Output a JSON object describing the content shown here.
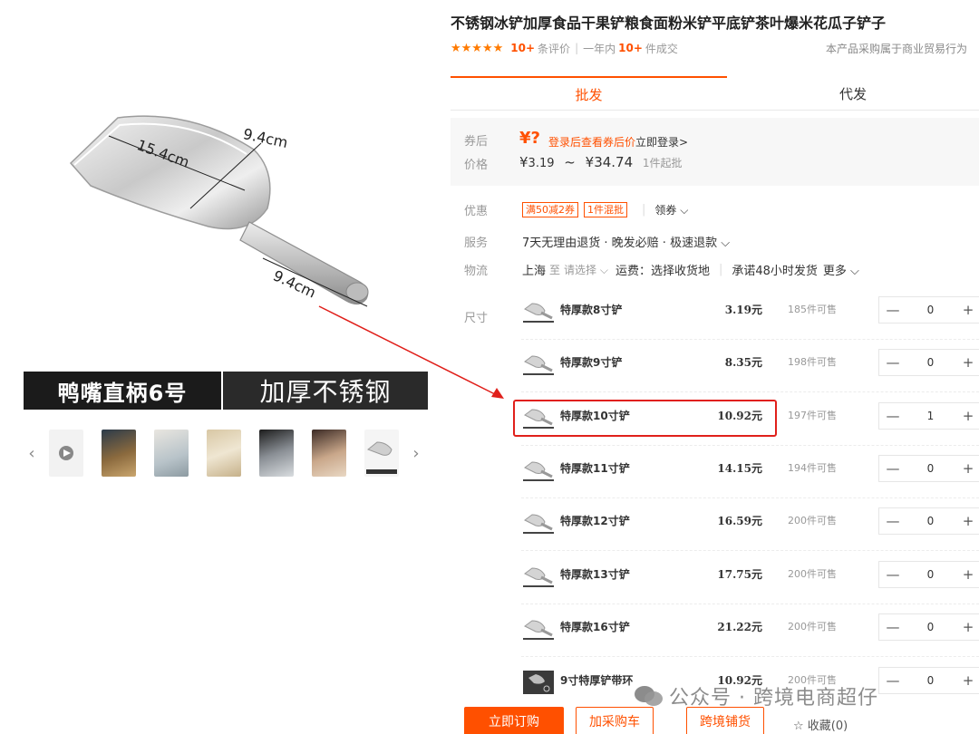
{
  "product": {
    "title": "不锈钢冰铲加厚食品干果铲粮食面粉米铲平底铲茶叶爆米花瓜子铲子",
    "rating_stars": "★★★★★",
    "reviews_count": "10+",
    "reviews_suffix": "条评价",
    "year_sales_prefix": "一年内",
    "year_sales_count": "10+",
    "year_sales_suffix": "件成交",
    "trade_note": "本产品采购属于商业贸易行为"
  },
  "image": {
    "dim_top": "9.4cm",
    "dim_diag": "15.4cm",
    "dim_handle": "9.4cm",
    "banner_left": "鸭嘴直柄6号",
    "banner_right": "加厚不锈钢",
    "prev_arrow": "‹",
    "next_arrow": "›"
  },
  "tabs": [
    {
      "label": "批发"
    },
    {
      "label": "代发"
    }
  ],
  "price": {
    "coupon_label": "券后",
    "price_label": "价格",
    "coupon_value": "¥?",
    "login_orange": "登录后查看券后价",
    "login_dark": "立即登录>",
    "range_low_symbol": "¥",
    "range_low": "3.19",
    "range_sep": "~",
    "range_high_symbol": "¥",
    "range_high": "34.74",
    "min_order": "1件起批"
  },
  "offers": {
    "label": "优惠",
    "tag1": "满50减2券",
    "tag2": "1件混批",
    "coupon_link": "领券 ⌵"
  },
  "service": {
    "label": "服务",
    "text": "7天无理由退货 · 晚发必赔 · 极速退款 ⌵"
  },
  "logistics": {
    "label": "物流",
    "from": "上海",
    "to_word": "至",
    "select": "请选择 ⌵",
    "fee": "运费：选择收货地",
    "promise": "承诺48小时发货",
    "more": "更多 ⌵"
  },
  "size_label": "尺寸",
  "skus": [
    {
      "name": "特厚款8寸铲",
      "price": "3.19元",
      "stock": "185件可售",
      "qty": "0"
    },
    {
      "name": "特厚款9寸铲",
      "price": "8.35元",
      "stock": "198件可售",
      "qty": "0"
    },
    {
      "name": "特厚款10寸铲",
      "price": "10.92元",
      "stock": "197件可售",
      "qty": "1"
    },
    {
      "name": "特厚款11寸铲",
      "price": "14.15元",
      "stock": "194件可售",
      "qty": "0"
    },
    {
      "name": "特厚款12寸铲",
      "price": "16.59元",
      "stock": "200件可售",
      "qty": "0"
    },
    {
      "name": "特厚款13寸铲",
      "price": "17.75元",
      "stock": "200件可售",
      "qty": "0"
    },
    {
      "name": "特厚款16寸铲",
      "price": "21.22元",
      "stock": "200件可售",
      "qty": "0"
    },
    {
      "name": "9寸特厚铲带环",
      "price": "10.92元",
      "stock": "200件可售",
      "qty": "0"
    }
  ],
  "stepper": {
    "minus": "—",
    "plus": "+"
  },
  "actions": {
    "buy": "立即订购",
    "cart": "加采购车",
    "shop": "跨境铺货",
    "favorite": "☆ 收藏(0)"
  },
  "watermark": "公众号 · 跨境电商超仔",
  "colors": {
    "accent": "#ff5000",
    "highlight": "#e0201b"
  }
}
